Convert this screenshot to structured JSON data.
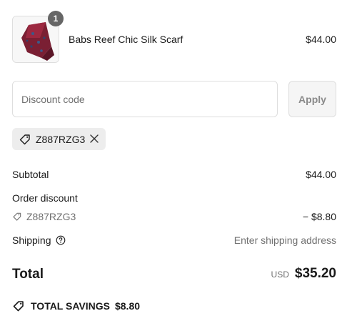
{
  "product": {
    "name": "Babs Reef Chic Silk Scarf",
    "price": "$44.00",
    "quantity": "1",
    "thumbnail_icon": "scarf-image"
  },
  "discount": {
    "placeholder": "Discount code",
    "apply_label": "Apply",
    "applied_code": "Z887RZG3"
  },
  "summary": {
    "subtotal_label": "Subtotal",
    "subtotal_value": "$44.00",
    "order_discount_label": "Order discount",
    "discount_code": "Z887RZG3",
    "discount_value": "− $8.80",
    "shipping_label": "Shipping",
    "shipping_value": "Enter shipping address",
    "total_label": "Total",
    "currency": "USD",
    "total_value": "$35.20",
    "savings_label": "TOTAL SAVINGS",
    "savings_value": "$8.80"
  },
  "colors": {
    "badge": "#666666",
    "muted_text": "#707070",
    "chip_bg": "#ededed",
    "border": "#dedede"
  }
}
